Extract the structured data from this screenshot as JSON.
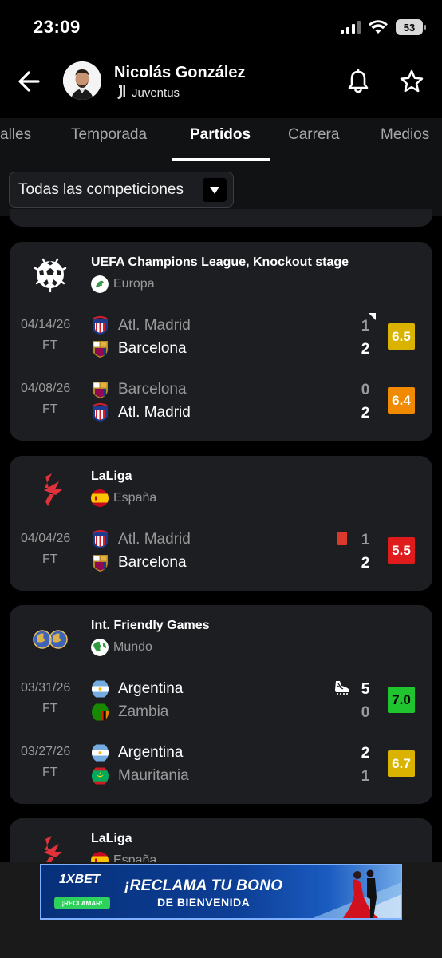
{
  "status_bar": {
    "time": "23:09",
    "battery": "53"
  },
  "header": {
    "player_name": "Nicolás González",
    "team": "Juventus"
  },
  "tabs": [
    {
      "label": "alles"
    },
    {
      "label": "Temporada"
    },
    {
      "label": "Partidos"
    },
    {
      "label": "Carrera"
    },
    {
      "label": "Medios"
    }
  ],
  "filter": {
    "selected": "Todas las competiciones"
  },
  "competitions": [
    {
      "name": "UEFA Champions League, Knockout stage",
      "region": "Europa",
      "matches": [
        {
          "date": "04/14/26",
          "status": "FT",
          "home": "Atl. Madrid",
          "away": "Barcelona",
          "home_score": "1",
          "away_score": "2",
          "rating": "6.5",
          "rating_color": "#d9b300"
        },
        {
          "date": "04/08/26",
          "status": "FT",
          "home": "Barcelona",
          "away": "Atl. Madrid",
          "home_score": "0",
          "away_score": "2",
          "rating": "6.4",
          "rating_color": "#f08a00"
        }
      ]
    },
    {
      "name": "LaLiga",
      "region": "España",
      "matches": [
        {
          "date": "04/04/26",
          "status": "FT",
          "home": "Atl. Madrid",
          "away": "Barcelona",
          "home_score": "1",
          "away_score": "2",
          "rating": "5.5",
          "rating_color": "#e01b1b"
        }
      ]
    },
    {
      "name": "Int. Friendly Games",
      "region": "Mundo",
      "matches": [
        {
          "date": "03/31/26",
          "status": "FT",
          "home": "Argentina",
          "away": "Zambia",
          "home_score": "5",
          "away_score": "0",
          "rating": "7.0",
          "rating_color": "#1fc42f"
        },
        {
          "date": "03/27/26",
          "status": "FT",
          "home": "Argentina",
          "away": "Mauritania",
          "home_score": "2",
          "away_score": "1",
          "rating": "6.7",
          "rating_color": "#d9b300"
        }
      ]
    },
    {
      "name": "LaLiga",
      "region": "España"
    }
  ],
  "ad": {
    "brand": "1XBET",
    "button": "¡RECLAMAR!",
    "headline": "¡RECLAMA TU BONO",
    "subline": "DE BIENVENIDA"
  }
}
